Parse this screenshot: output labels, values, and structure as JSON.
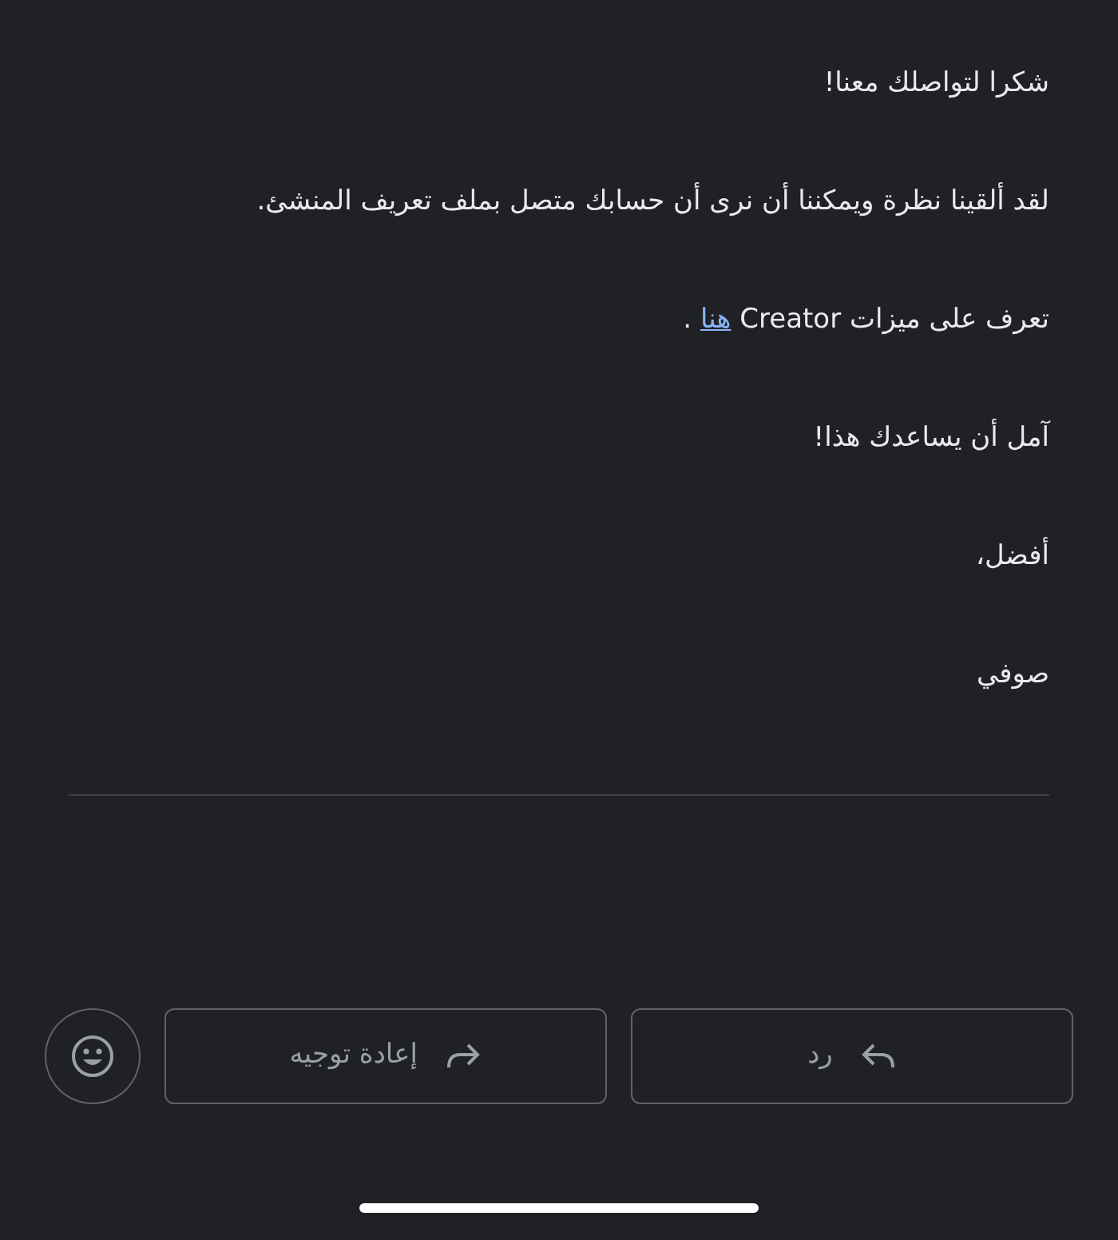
{
  "message": {
    "paragraphs": [
      {
        "kind": "text",
        "text": "شكرا لتواصلك معنا!"
      },
      {
        "kind": "text",
        "text": "لقد ألقينا نظرة ويمكننا أن نرى أن حسابك متصل بملف تعريف المنشئ."
      },
      {
        "kind": "link",
        "before": "تعرف على ميزات Creator ",
        "link": "هنا",
        "after": " ."
      },
      {
        "kind": "text",
        "text": "آمل أن يساعدك هذا!"
      },
      {
        "kind": "text",
        "text": "أفضل،"
      },
      {
        "kind": "text",
        "text": "صوفي"
      }
    ]
  },
  "actions": [
    {
      "kind": "reply",
      "label": "رد"
    },
    {
      "kind": "forward",
      "label": "إعادة توجيه"
    },
    {
      "kind": "emoji"
    }
  ]
}
